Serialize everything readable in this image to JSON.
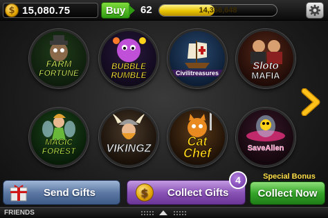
{
  "header": {
    "coin_symbol": "$",
    "balance": "15,080.75",
    "buy_label": "Buy",
    "level": "62",
    "xp": "14,356,648",
    "xp_progress": 0.47
  },
  "games": [
    {
      "name": "Farm Fortune",
      "line1": "FARM",
      "line2": "FORTUNE",
      "color": "#c8e65a"
    },
    {
      "name": "Bubble Rumble",
      "line1": "BUBBLE",
      "line2": "RUMBLE",
      "color": "#ffe640"
    },
    {
      "name": "Civilitreasures",
      "line1": "",
      "line2": "Civilitreasures",
      "color": "#ffffff"
    },
    {
      "name": "Sloto Mafia",
      "line1": "Sloto",
      "line2": "MAFIA",
      "color": "#ffffff"
    },
    {
      "name": "Magic Forest",
      "line1": "MAGIC",
      "line2": "FOREST",
      "color": "#b6e84a"
    },
    {
      "name": "Viking Z",
      "line1": "",
      "line2": "VIKINGZ",
      "color": "#f0f0f0"
    },
    {
      "name": "Cat Chef",
      "line1": "Cat",
      "line2": "Chef",
      "color": "#ffd21a"
    },
    {
      "name": "Save Alien",
      "line1": "",
      "line2": "SaveAlien",
      "color": "#ff6fb4"
    }
  ],
  "bottom": {
    "send_gifts_label": "Send Gifts",
    "collect_gifts_label": "Collect Gifts",
    "collect_gifts_count": "4",
    "special_bonus_label": "Special Bonus",
    "collect_now_label": "Collect Now",
    "friends_label": "FRIENDS"
  },
  "colors": {
    "buy_green": "#2f9a12",
    "xp_gold": "#e8c400",
    "send_blue": "#5d79a4",
    "collect_purple": "#8b55b8",
    "collect_now_green": "#35a52a",
    "bonus_yellow": "#ffe14a"
  },
  "icons": {
    "coin": "coin-icon",
    "settings": "gear-icon",
    "next": "chevron-right-icon",
    "gift": "gift-icon",
    "friends_toggle": "chevron-up-icon"
  }
}
